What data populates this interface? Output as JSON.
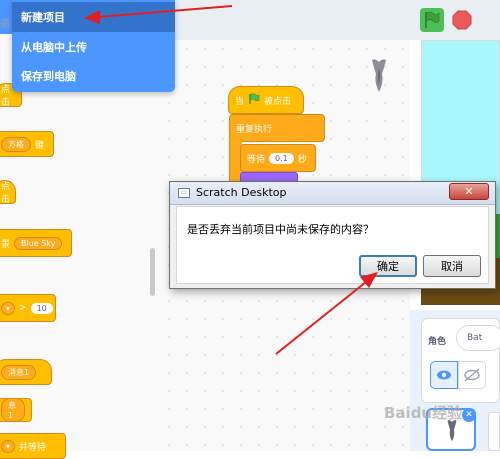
{
  "menu_bar": {
    "fragment_text": "造"
  },
  "file_menu": {
    "items": [
      {
        "label": "新建项目"
      },
      {
        "label": "从电脑中上传"
      },
      {
        "label": "保存到电脑"
      }
    ]
  },
  "palette": {
    "blocks": [
      {
        "text": "点击"
      },
      {
        "text": "方格",
        "suffix": "键"
      },
      {
        "text": "点击"
      },
      {
        "text": "景",
        "dropdown": "Blue Sky"
      },
      {
        "operator": ">",
        "value": "10"
      },
      {
        "dropdown": "消息1"
      },
      {
        "dropdown": "息1"
      },
      {
        "text": "并等待"
      }
    ]
  },
  "script": {
    "when_flag_prefix": "当",
    "when_flag_suffix": "被点击",
    "forever": "重复执行",
    "wait_label": "等待",
    "wait_value": "0.1",
    "wait_unit": "秒"
  },
  "stage": {
    "sprite_label": "角色",
    "sprite_name": "Bat"
  },
  "dialog": {
    "title": "Scratch Desktop",
    "message": "是否丢弃当前项目中尚未保存的内容？",
    "ok_label": "确定",
    "cancel_label": "取消",
    "close_glyph": "✕"
  },
  "watermark": {
    "text": "Baidu经验"
  },
  "colors": {
    "menu_blue": "#4c97ff",
    "menu_highlight": "#3373cc",
    "event_block": "#ffbf00",
    "control_block": "#ffab19",
    "arrow_red": "#e02020",
    "stage_sky": "#a9f8ff"
  }
}
